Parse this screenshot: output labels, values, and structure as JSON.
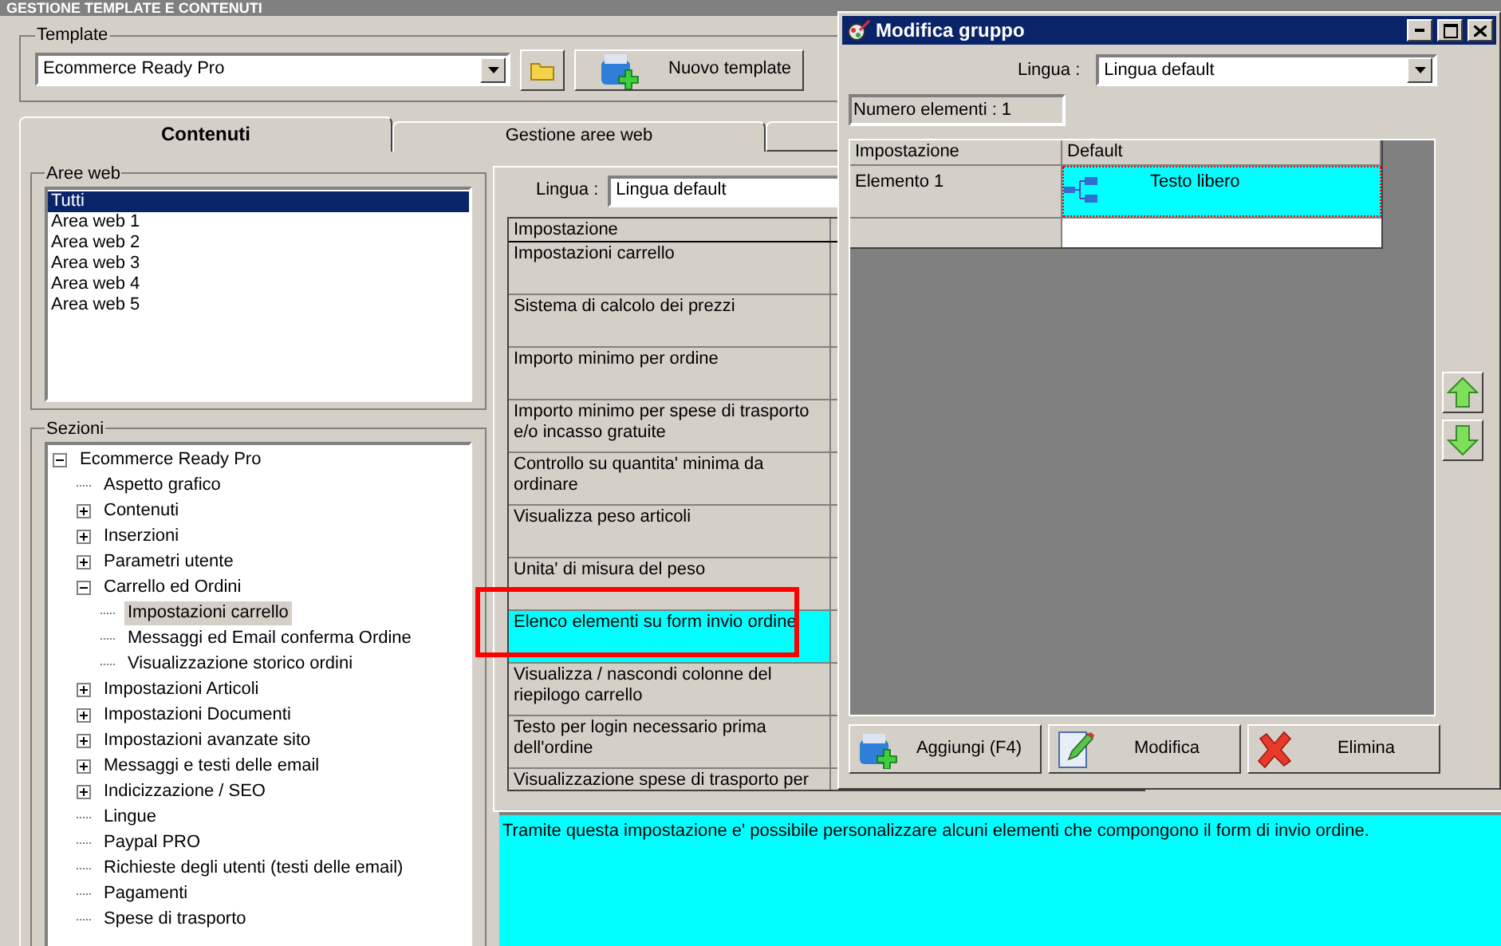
{
  "window": {
    "title": "GESTIONE TEMPLATE E CONTENUTI"
  },
  "template": {
    "label": "Template",
    "value": "Ecommerce Ready Pro",
    "new_button": "Nuovo template"
  },
  "tabs": [
    {
      "label": "Contenuti",
      "selected": true
    },
    {
      "label": "Gestione aree web",
      "selected": false
    }
  ],
  "aree_web": {
    "label": "Aree web",
    "items": [
      {
        "label": "Tutti",
        "selected": true
      },
      {
        "label": "Area web 1",
        "selected": false
      },
      {
        "label": "Area web 2",
        "selected": false
      },
      {
        "label": "Area web 3",
        "selected": false
      },
      {
        "label": "Area web 4",
        "selected": false
      },
      {
        "label": "Area web 5",
        "selected": false
      }
    ]
  },
  "sezioni": {
    "label": "Sezioni",
    "tree": [
      {
        "label": "Ecommerce Ready Pro",
        "expanded": true,
        "selected": false,
        "children": [
          {
            "label": "Aspetto grafico",
            "selected": false
          },
          {
            "label": "Contenuti",
            "expanded": false,
            "selected": false
          },
          {
            "label": "Inserzioni",
            "expanded": false,
            "selected": false
          },
          {
            "label": "Parametri utente",
            "expanded": false,
            "selected": false
          },
          {
            "label": "Carrello ed Ordini",
            "expanded": true,
            "selected": false,
            "children": [
              {
                "label": "Impostazioni carrello",
                "selected": true
              },
              {
                "label": "Messaggi ed Email conferma Ordine",
                "selected": false
              },
              {
                "label": "Visualizzazione storico ordini",
                "selected": false
              }
            ]
          },
          {
            "label": "Impostazioni Articoli",
            "expanded": false,
            "selected": false
          },
          {
            "label": "Impostazioni Documenti",
            "expanded": false,
            "selected": false
          },
          {
            "label": "Impostazioni avanzate sito",
            "expanded": false,
            "selected": false
          },
          {
            "label": "Messaggi e testi delle email",
            "expanded": false,
            "selected": false
          },
          {
            "label": "Indicizzazione / SEO",
            "expanded": false,
            "selected": false
          },
          {
            "label": "Lingue",
            "selected": false
          },
          {
            "label": "Paypal PRO",
            "selected": false
          },
          {
            "label": "Richieste degli utenti (testi delle email)",
            "selected": false
          },
          {
            "label": "Pagamenti",
            "selected": false
          },
          {
            "label": "Spese di trasporto",
            "selected": false
          }
        ]
      }
    ]
  },
  "settings": {
    "language_label": "Lingua :",
    "language_value": "Lingua default",
    "column": "Impostazione",
    "rows": [
      {
        "label": "Impostazioni carrello",
        "selected": false
      },
      {
        "label": "Sistema di calcolo dei prezzi",
        "selected": false
      },
      {
        "label": "Importo minimo per ordine",
        "selected": false
      },
      {
        "label": "Importo minimo per spese di trasporto e/o incasso gratuite",
        "selected": false
      },
      {
        "label": "Controllo su quantita' minima da ordinare",
        "selected": false
      },
      {
        "label": "Visualizza peso articoli",
        "selected": false
      },
      {
        "label": "Unita' di misura del peso",
        "selected": false
      },
      {
        "label": "Elenco elementi su form invio ordine",
        "selected": true
      },
      {
        "label": "Visualizza / nascondi colonne del riepilogo carrello",
        "selected": false
      },
      {
        "label": "Testo per login necessario prima dell'ordine",
        "selected": false
      },
      {
        "label": "Visualizzazione spese di trasporto per",
        "selected": false
      }
    ]
  },
  "description": "Tramite questa impostazione e' possibile personalizzare alcuni elementi che compongono il form di invio ordine.",
  "dialog": {
    "title": "Modifica gruppo",
    "language_label": "Lingua :",
    "language_value": "Lingua default",
    "count": "Numero elementi : 1",
    "columns": [
      "Impostazione",
      "Default"
    ],
    "rows": [
      {
        "name": "Elemento 1",
        "value": "Testo libero",
        "selected": true
      }
    ],
    "buttons": [
      {
        "label": "Aggiungi (F4)",
        "kind": "add"
      },
      {
        "label": "Modifica",
        "kind": "edit"
      },
      {
        "label": "Elimina",
        "kind": "delete"
      }
    ]
  }
}
